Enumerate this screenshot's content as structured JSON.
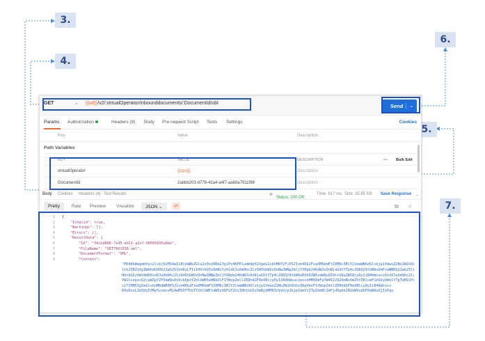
{
  "callouts": [
    "3.",
    "4.",
    "5.",
    "6.",
    "7."
  ],
  "request": {
    "method": "GET",
    "url_var": "{{url}}",
    "url_path": "/v2/:virtualOperator/inbounddocuments/:DocumentId/ubl",
    "send_label": "Send"
  },
  "tabs": {
    "params": "Params",
    "authorization": "Authorization",
    "headers": "Headers (9)",
    "body": "Body",
    "prerequest": "Pre-request Script",
    "tests": "Tests",
    "settings": "Settings",
    "cookies": "Cookies"
  },
  "params_table": {
    "key": "Key",
    "value": "Value",
    "description": "Description"
  },
  "path_variables": {
    "title": "Path Variables",
    "headers": {
      "key": "KEY",
      "value": "VALUE",
      "description": "DESCRIPTION",
      "more": "•••",
      "bulk": "Bulk Edit"
    },
    "rows": [
      {
        "key": "virtualOperator",
        "value": "{{cpvj}}",
        "description": "Description"
      },
      {
        "key": "DocumentId",
        "value": "2abbb203-d778-42a4-a4f7-aa8da7911f86",
        "description": "Description"
      }
    ]
  },
  "response_bar": {
    "body": "Body",
    "cookies": "Cookies",
    "headers": "Headers (4)",
    "test_results": "Test Results",
    "status": "Status: 200 OK",
    "time": "Time: 617 ms",
    "size": "Size: 25.85 KB",
    "save": "Save Response"
  },
  "format_bar": {
    "pretty": "Pretty",
    "raw": "Raw",
    "preview": "Preview",
    "visualize": "Visualize",
    "format": "JSON"
  },
  "editor": {
    "line_numbers": [
      "1",
      "2",
      "3",
      "4",
      "5",
      "6",
      "7",
      "8",
      "9"
    ],
    "lines": [
      "{",
      "\"IsValid\": true,",
      "\"Warnings\": [],",
      "\"Errors\": [],",
      "\"ResultData\": {",
      "\"Id\": \"34c1d896-7a35-eb11-a2cf-00505695a8eb\",",
      "\"FileName\": \"SET7601538.xml\",",
      "\"DocumentFormat\": \"XML\",",
      "\"Content\":"
    ],
    "content_blob": [
      "\"PD94bWwgdmVyc2lvbj0iMS4wIiBlbmNvZGluZz0idXRmLTgiPz4KPEludm9pY2UgeG1sbnM6Y2FjPSJ1cm46b2FzaXM6bmFtZXM6c3BlY2lmaWNhdGlvbjp1YmwuZ2NoZW1hOnhzZDpDb2",
      "1tb25BZ2dyZWdhdGVDb21wb25lbnRzLTIiIHhtbG5zOmNiYz0idXJuOm9hc2lzOm5hbWVzOnNwZWNpZmljYXRpb246dWJsOnNjaGVtYTp4c2Q6Q29tbW9uQmFzaWNDb21wb25lbnRzLTIiI",
      "HhtbG5zOmV4dD0idXJuOm9hc2lzOm5hbWVzOnNwZWNpZmljYXRpb246dWJsOnNjaGVtYTp4c2Q6Q29tbW9uRXh0ZW5zaW9uQ29tcG9uZW50cy0yIiB4bWxucz0idXJuOm9hc2lzOm5hbWVzOnNwZ",
      "YW1lczpzcGVjaWZpY2F0aW9uOnVibDpzY2hlbWE6eHNkOlF1YWxpZmllZERhdGF0eXBlcy0yIiB4bWxuczpzcdHM9ImFpYW462292OmNvOmZhY3RlcmF1bGVyOmhlYTpTdH1VYmhlcjJsYTpVdW",
      "ciTIHM5Ig5eGlsbnM6dWR0PSJ1cm46b2FzaXM6bmFtZXM6c3BlY2lmaWNhdGlvbjp1YmwuZ2NoZW1hOnhzZDpVbnF1YWxpZmllZERhdGF0eXBlcy0yIiB4bWxucz",
      "R0cDovL3d3dy53My5vcmcvMjAwMS9YTUxTY2hlbWEtaW5zdGFuY2UiIHhtbG5zOmNjdHM9InVybjp1bjp1bmVjZTp1bmNlZmFjdDpkb2N1bWVudGF0aW9uOjIiPgo"
    ]
  }
}
